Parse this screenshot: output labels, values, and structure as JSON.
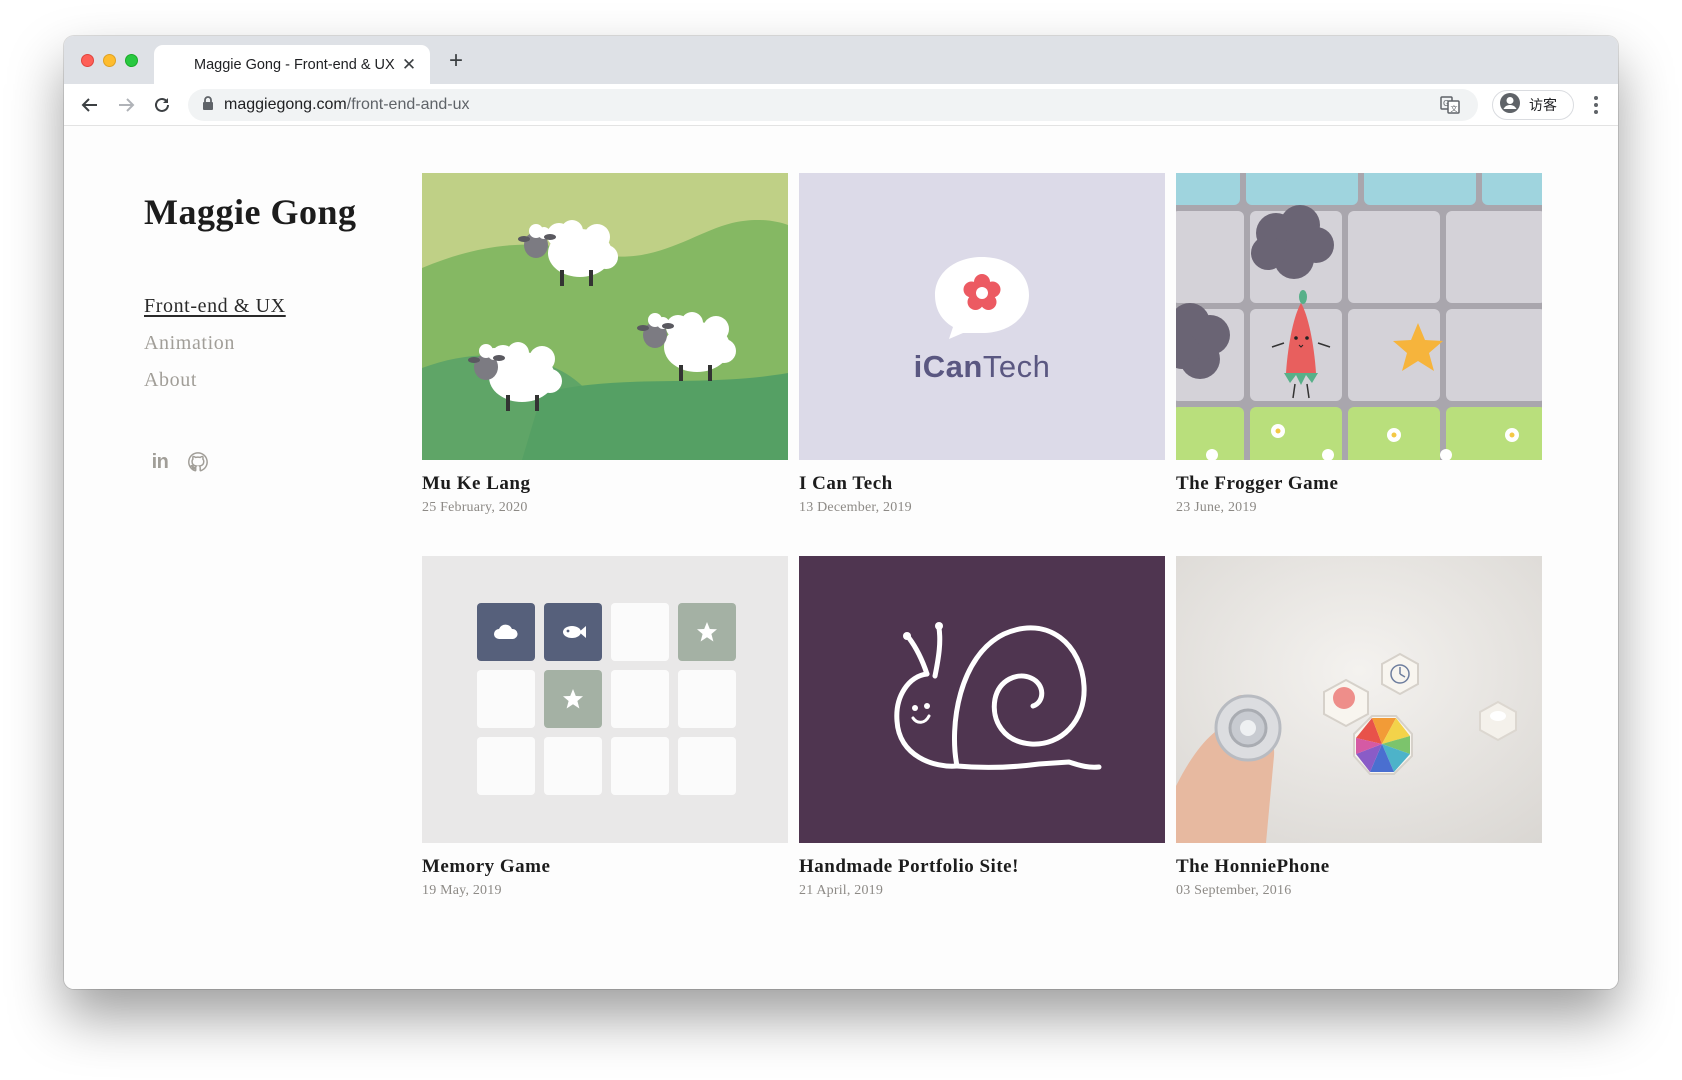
{
  "browser": {
    "tab_title": "Maggie Gong - Front-end & UX",
    "url_host": "maggiegong.com",
    "url_path": "/front-end-and-ux",
    "profile_label": "访客"
  },
  "site": {
    "title": "Maggie Gong",
    "nav": [
      {
        "label": "Front-end & UX",
        "active": true
      },
      {
        "label": "Animation",
        "active": false
      },
      {
        "label": "About",
        "active": false
      }
    ],
    "social_icons": [
      "linkedin-icon",
      "github-icon"
    ]
  },
  "projects": [
    {
      "title": "Mu Ke Lang",
      "date": "25 February, 2020",
      "thumb": "sheep-illustration"
    },
    {
      "title": "I Can Tech",
      "date": "13 December, 2019",
      "thumb": "icantech-logo",
      "logo_bold": "iCan",
      "logo_light": "Tech"
    },
    {
      "title": "The Frogger Game",
      "date": "23 June, 2019",
      "thumb": "frogger-tiles"
    },
    {
      "title": "Memory Game",
      "date": "19 May, 2019",
      "thumb": "memory-tiles"
    },
    {
      "title": "Handmade Portfolio Site!",
      "date": "21 April, 2019",
      "thumb": "snail-drawing"
    },
    {
      "title": "The HonniePhone",
      "date": "03 September, 2016",
      "thumb": "honniephone-photo"
    }
  ],
  "colors": {
    "accent_dark": "#1c1c1c",
    "muted": "#a19e98",
    "icantech_bg": "#dcdae8",
    "icantech_text": "#5a5781",
    "snail_bg": "#4f3550",
    "memory_bg": "#e9e8e8"
  }
}
